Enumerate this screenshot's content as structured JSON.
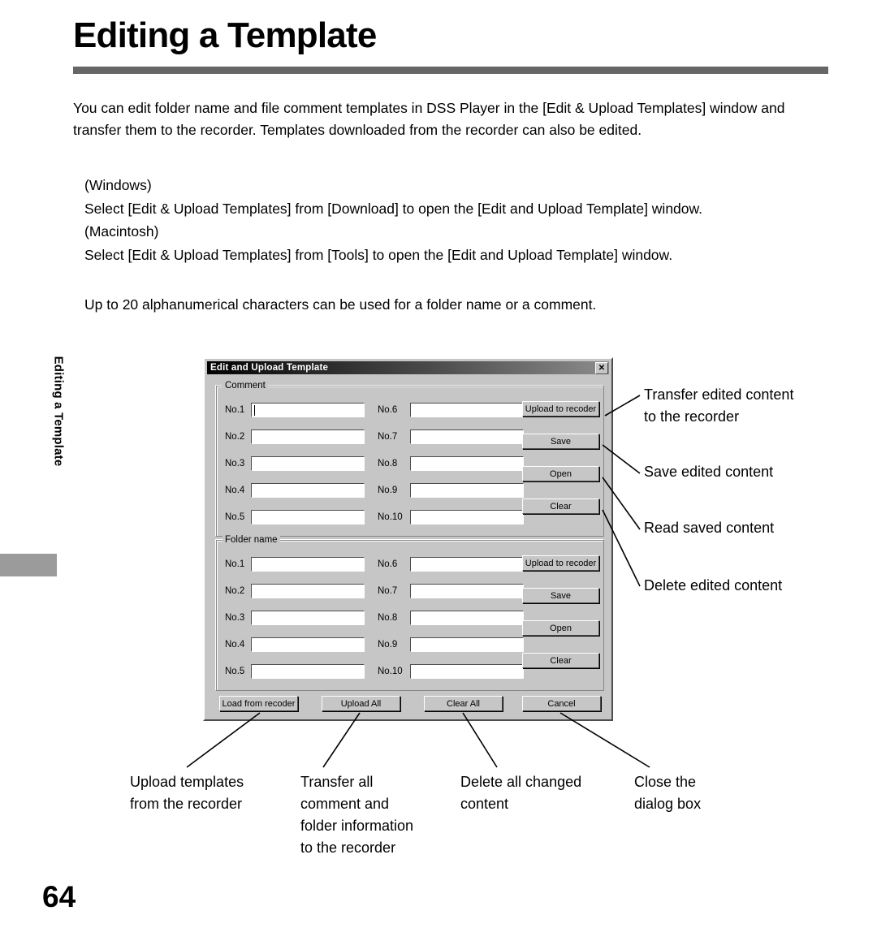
{
  "page": {
    "title": "Editing a Template",
    "side_tab_label": "Editing a Template",
    "page_number": "64",
    "rule_color": "#666666"
  },
  "body": {
    "intro": "You can edit folder name and file comment templates in DSS Player in the [Edit & Upload Templates] window and transfer them to the recorder. Templates downloaded from the recorder can also be edited.",
    "platform_instructions": "(Windows)\nSelect [Edit & Upload Templates] from [Download] to open the [Edit and Upload Template] window.\n(Macintosh)\nSelect [Edit & Upload Templates] from [Tools] to open the [Edit and Upload Template] window.",
    "limit_note": "Up to 20 alphanumerical characters can be used for a folder name or a comment."
  },
  "dialog": {
    "title": "Edit and Upload Template",
    "close_icon": "✕",
    "groups": [
      {
        "legend": "Comment",
        "left_fields": [
          {
            "label": "No.1",
            "value": "",
            "focused": true
          },
          {
            "label": "No.2",
            "value": "",
            "focused": false
          },
          {
            "label": "No.3",
            "value": "",
            "focused": false
          },
          {
            "label": "No.4",
            "value": "",
            "focused": false
          },
          {
            "label": "No.5",
            "value": "",
            "focused": false
          }
        ],
        "right_fields": [
          {
            "label": "No.6",
            "value": ""
          },
          {
            "label": "No.7",
            "value": ""
          },
          {
            "label": "No.8",
            "value": ""
          },
          {
            "label": "No.9",
            "value": ""
          },
          {
            "label": "No.10",
            "value": ""
          }
        ],
        "buttons": [
          {
            "label": "Upload to recoder"
          },
          {
            "label": "Save"
          },
          {
            "label": "Open"
          },
          {
            "label": "Clear"
          }
        ]
      },
      {
        "legend": "Folder name",
        "left_fields": [
          {
            "label": "No.1",
            "value": "",
            "focused": false
          },
          {
            "label": "No.2",
            "value": "",
            "focused": false
          },
          {
            "label": "No.3",
            "value": "",
            "focused": false
          },
          {
            "label": "No.4",
            "value": "",
            "focused": false
          },
          {
            "label": "No.5",
            "value": "",
            "focused": false
          }
        ],
        "right_fields": [
          {
            "label": "No.6",
            "value": ""
          },
          {
            "label": "No.7",
            "value": ""
          },
          {
            "label": "No.8",
            "value": ""
          },
          {
            "label": "No.9",
            "value": ""
          },
          {
            "label": "No.10",
            "value": ""
          }
        ],
        "buttons": [
          {
            "label": "Upload to recoder"
          },
          {
            "label": "Save"
          },
          {
            "label": "Open"
          },
          {
            "label": "Clear"
          }
        ]
      }
    ],
    "bottom_buttons": [
      {
        "label": "Load from recoder"
      },
      {
        "label": "Upload All"
      },
      {
        "label": "Clear All"
      },
      {
        "label": "Cancel"
      }
    ]
  },
  "callouts": {
    "right": [
      "Transfer edited content\nto the recorder",
      "Save edited content",
      "Read saved content",
      "Delete edited content"
    ],
    "bottom": [
      "Upload templates\nfrom the recorder",
      "Transfer all\ncomment and\nfolder information\nto the recorder",
      "Delete all changed\ncontent",
      "Close  the\ndialog box"
    ]
  }
}
